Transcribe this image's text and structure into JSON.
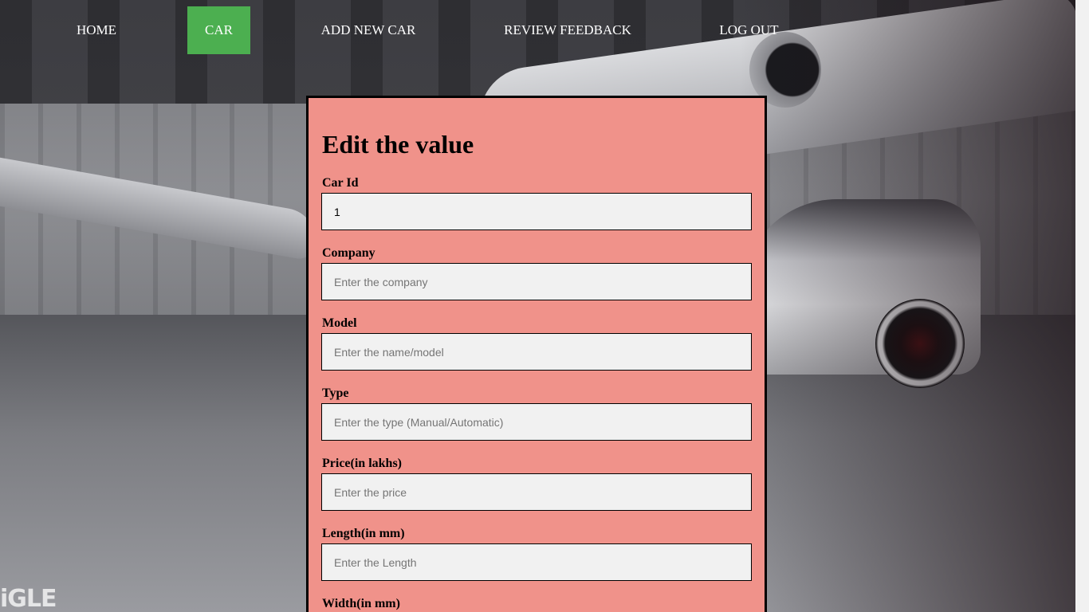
{
  "nav": {
    "items": [
      {
        "label": "HOME",
        "active": false
      },
      {
        "label": "CAR",
        "active": true
      },
      {
        "label": "ADD NEW CAR",
        "active": false
      },
      {
        "label": "REVIEW FEEDBACK",
        "active": false
      },
      {
        "label": "LOG OUT",
        "active": false
      }
    ],
    "active_color": "#4caf50"
  },
  "form": {
    "title": "Edit the value",
    "background_color": "#f0928a",
    "fields": [
      {
        "label": "Car Id",
        "value": "1",
        "placeholder": ""
      },
      {
        "label": "Company",
        "value": "",
        "placeholder": "Enter the company"
      },
      {
        "label": "Model",
        "value": "",
        "placeholder": "Enter the name/model"
      },
      {
        "label": "Type",
        "value": "",
        "placeholder": "Enter the type (Manual/Automatic)"
      },
      {
        "label": "Price(in lakhs)",
        "value": "",
        "placeholder": "Enter the price"
      },
      {
        "label": "Length(in mm)",
        "value": "",
        "placeholder": "Enter the Length"
      },
      {
        "label": "Width(in mm)",
        "value": "",
        "placeholder": ""
      }
    ]
  },
  "background": {
    "logo_text": "iGLE"
  }
}
